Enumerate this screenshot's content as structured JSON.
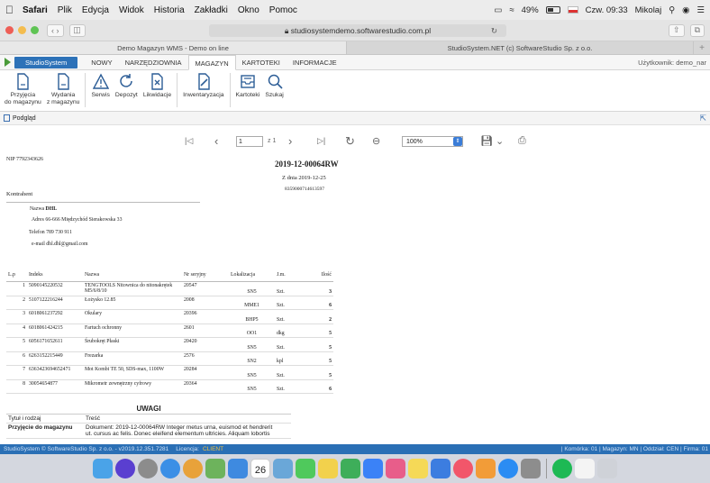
{
  "menubar": {
    "app": "Safari",
    "items": [
      "Plik",
      "Edycja",
      "Widok",
      "Historia",
      "Zakładki",
      "Okno",
      "Pomoc"
    ],
    "battery": "49%",
    "clock": "Czw. 09:33",
    "user": "Mikolaj"
  },
  "browser": {
    "url": "studiosystemdemo.softwarestudio.com.pl",
    "tabs": [
      "Demo Magazyn WMS - Demo on line",
      "StudioSystem.NET (c) SoftwareStudio Sp. z o.o."
    ]
  },
  "app": {
    "brand": "StudioSystem",
    "nav": [
      "NOWY",
      "NARZĘDZIOWNIA",
      "MAGAZYN",
      "KARTOTEKI",
      "INFORMACJE"
    ],
    "user_label": "Użytkownik: demo_nar"
  },
  "ribbon": {
    "items": [
      {
        "icon": "document-icon",
        "line1": "Przyjęcia",
        "line2": "do magazynu"
      },
      {
        "icon": "document-icon",
        "line1": "Wydania",
        "line2": "z magazynu"
      },
      {
        "icon": "warning-icon",
        "line1": "Serwis",
        "line2": ""
      },
      {
        "icon": "refresh-icon",
        "line1": "Depozyt",
        "line2": ""
      },
      {
        "icon": "cancel-document-icon",
        "line1": "Likwidacje",
        "line2": ""
      },
      {
        "icon": "edit-document-icon",
        "line1": "Inwentaryzacja",
        "line2": ""
      },
      {
        "icon": "tray-icon",
        "line1": "Kartoteki",
        "line2": ""
      },
      {
        "icon": "search-icon",
        "line1": "Szukaj",
        "line2": ""
      }
    ]
  },
  "preview": {
    "title": "Podgląd",
    "page_value": "1",
    "page_of": "z 1",
    "zoom": "100%"
  },
  "document": {
    "nip": "NIP 7792343626",
    "number": "2019-12-00064RW",
    "date": "Z dnia 2019-12-25",
    "barcode": "8359000714613597",
    "contractor_label": "Kontrahent",
    "name_label": "Nazwa",
    "name": "DHL",
    "address_label": "Adres",
    "address": "66-666 Międzychód Sierakowska 33",
    "phone_label": "Telefon",
    "phone": "789 730 911",
    "email_label": "e-mail",
    "email": "dhl.dhl@gmail.com",
    "table_headers": [
      "L.p",
      "Indeks",
      "Nazwa",
      "Nr seryjny",
      "Lokalizacja",
      "J.m.",
      "Ilość"
    ],
    "rows": [
      [
        "1",
        "5090145220532",
        "TENGTOOLS Nitownica do nitonakrętek M5/6/8/10",
        "20547",
        "SN5",
        "Szt.",
        "3"
      ],
      [
        "2",
        "5107122216244",
        "Łożysko 12.85",
        "2008",
        "MME1",
        "Szt.",
        "6"
      ],
      [
        "3",
        "6018061237292",
        "Okulary",
        "20396",
        "BHP5",
        "Szt.",
        "2"
      ],
      [
        "4",
        "6018061424215",
        "Fartuch ochronny",
        "2601",
        "OO1",
        "dkg",
        "5"
      ],
      [
        "5",
        "6056171652611",
        "Śrubokręt Płaski",
        "20420",
        "SN5",
        "Szt.",
        "5"
      ],
      [
        "6",
        "6263152215449",
        "Frezarka",
        "2576",
        "SN2",
        "kpl",
        "5"
      ],
      [
        "7",
        "6363423694652471",
        "Mot Kombi TE 50, SDS-max, 1100W",
        "20284",
        "SN5",
        "Szt.",
        "5"
      ],
      [
        "8",
        "30054654877",
        "Mikrometr zewnętrzny cyfrowy",
        "20364",
        "SN5",
        "Szt.",
        "6"
      ]
    ],
    "notes": {
      "title": "UWAGI",
      "col1": "Tytuł i rodzaj",
      "col2": "Treść",
      "row_title": "Przyjęcie do magazynu",
      "row_text_1": "Dokument: 2019-12-00064RW Integer metus urna, euismod et hendrerit",
      "row_text_2": "ut. cursus ac felis. Donec eleifend elementum ultricies. Aliquam lobortis"
    }
  },
  "statusbar": {
    "left": "StudioSystem © SoftwareStudio Sp. z o.o. - v2019.12.351.7281",
    "licence": "Licencja:",
    "licence_value": "CLIENT",
    "right": "| Komórka: 01 | Magazyn: MN | Oddział: CEN | Firma: 01"
  },
  "dock": {
    "calendar_day": "26",
    "icons": [
      "finder-icon",
      "siri-icon",
      "launchpad-icon",
      "safari-icon",
      "chrome-icon",
      "photos-icon",
      "mail-icon",
      "calendar-icon",
      "preview-icon",
      "messages-icon",
      "notes-icon",
      "numbers-icon",
      "help-icon",
      "photos2-icon",
      "stickies-icon",
      "keynote-icon",
      "music-icon",
      "books-icon",
      "appstore-icon",
      "preferences-icon",
      "spotify-icon",
      "document-icon",
      "trash-icon"
    ]
  }
}
